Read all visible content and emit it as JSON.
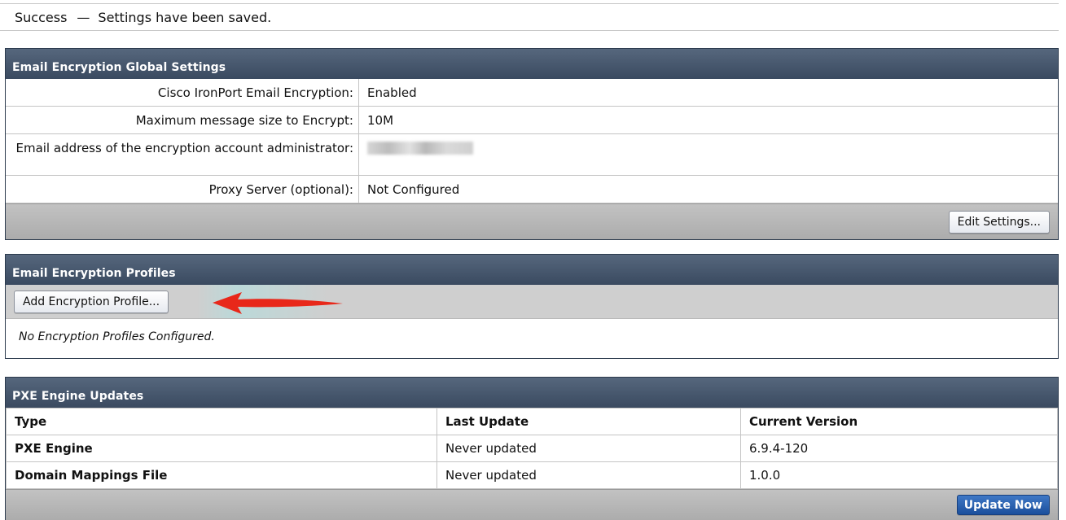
{
  "notice": {
    "status": "Success",
    "dash": "—",
    "message": "Settings have been saved."
  },
  "global_settings": {
    "title": "Email Encryption Global Settings",
    "rows": [
      {
        "label": "Cisco IronPort Email Encryption:",
        "value": "Enabled"
      },
      {
        "label": "Maximum message size to Encrypt:",
        "value": "10M"
      },
      {
        "label": "Email address of the encryption account administrator:",
        "value": ""
      },
      {
        "label": "Proxy Server (optional):",
        "value": "Not Configured"
      }
    ],
    "edit_button": "Edit Settings..."
  },
  "profiles": {
    "title": "Email Encryption Profiles",
    "add_button": "Add Encryption Profile...",
    "empty_message": "No Encryption Profiles Configured.",
    "arrow_color": "#e8281a"
  },
  "pxe": {
    "title": "PXE Engine Updates",
    "columns": [
      "Type",
      "Last Update",
      "Current Version"
    ],
    "rows": [
      {
        "type": "PXE Engine",
        "last_update": "Never updated",
        "version": "6.9.4-120"
      },
      {
        "type": "Domain Mappings File",
        "last_update": "Never updated",
        "version": "1.0.0"
      }
    ],
    "update_button": "Update Now"
  },
  "colors": {
    "header_bg": "#45566c",
    "primary_button": "#2a5fae"
  }
}
